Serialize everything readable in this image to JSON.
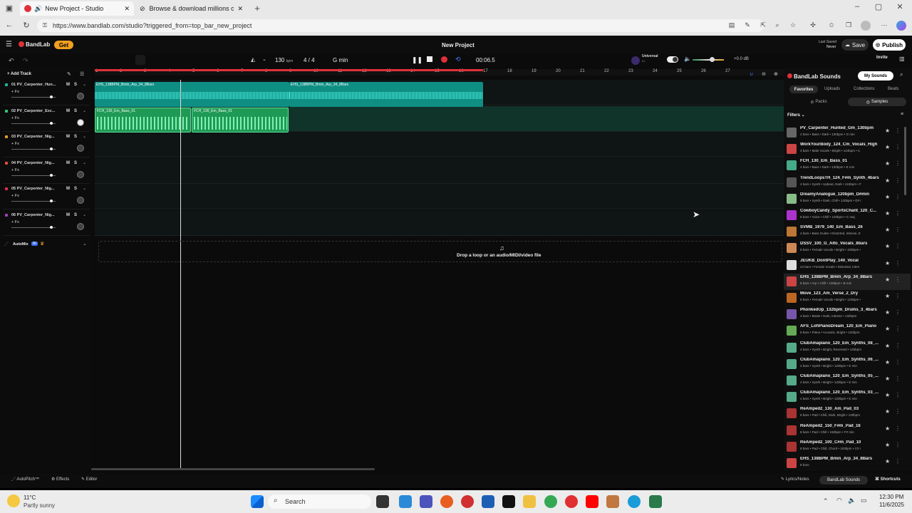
{
  "browser": {
    "tab1": "New Project - Studio",
    "tab2": "Browse & download millions of p",
    "url": "https://www.bandlab.com/studio?triggered_from=top_bar_new_project"
  },
  "header": {
    "brand": "BandLab",
    "get": "Get",
    "title": "New Project",
    "last_saved_label": "Last Saved",
    "last_saved_value": "Never",
    "save": "Save",
    "publish": "Publish",
    "invite": "Invite"
  },
  "transport": {
    "bpm": "130",
    "bpm_unit": "bpm",
    "signature": "4 / 4",
    "key": "G min",
    "time": "00:06.5",
    "universal": "Universal",
    "universal_sub": "60",
    "db": "+0.0 dB"
  },
  "tracks_panel": {
    "add_track": "Add Track",
    "automix": "AutoMix",
    "ai": "AI"
  },
  "tracks": [
    {
      "name": "01 PV_Carpenter_Hun...",
      "fx": "+ Fx"
    },
    {
      "name": "02 PV_Carpenter_Exc...",
      "fx": "+ Fx"
    },
    {
      "name": "03 PV_Carpenter_Nig...",
      "fx": "+ Fx"
    },
    {
      "name": "04 PV_Carpenter_Nig...",
      "fx": "+ Fx"
    },
    {
      "name": "05 PV_Carpenter_Nig...",
      "fx": "+ Fx"
    },
    {
      "name": "06 PV_Carpenter_Nig...",
      "fx": "+ Fx"
    }
  ],
  "track_controls": {
    "mute": "M",
    "solo": "S"
  },
  "ruler": [
    "1",
    "2",
    "3",
    "4",
    "5",
    "6",
    "7",
    "8",
    "9",
    "10",
    "11",
    "12",
    "13",
    "14",
    "15",
    "16",
    "17",
    "18",
    "19",
    "20",
    "21",
    "22",
    "23",
    "24",
    "25",
    "26",
    "27"
  ],
  "clips": {
    "a": "EHS_138BPM_Bmin_Arp_34_8Bars",
    "b": "EHS_138BPM_Bmin_Arp_34_8Bars",
    "c": "FCH_130_Em_Bass_01",
    "d": "FCH_130_Em_Bass_01"
  },
  "drop_text": "Drop a loop or an audio/MIDI/video file",
  "sounds_panel": {
    "title": "BandLab Sounds",
    "my_sounds": "My Sounds",
    "tabs": [
      "Favorites",
      "Uploads",
      "Collections",
      "Beats"
    ],
    "packs": "Packs",
    "samples": "Samples",
    "filters": "Filters"
  },
  "sounds": [
    {
      "title": "PV_Carpenter_Hunted_Gm_130bpm",
      "meta": "4 bars • Bass • Dark • 130bpm • G min",
      "color": "#666"
    },
    {
      "title": "WorkYourBody_124_Cm_Vocals_High",
      "meta": "4 bars • Male Vocals • Bright • 124bpm • C",
      "color": "#c44"
    },
    {
      "title": "FCH_130_Em_Bass_01",
      "meta": "4 bars • Bass • Dark • 130bpm • E min",
      "color": "#4a8"
    },
    {
      "title": "TrendLoopsTH_124_F#m_Synth_4bars",
      "meta": "4 bars • Synth • Upbeat, Dark • 124bpm • F",
      "color": "#555"
    },
    {
      "title": "DreamyAnalogue_120bpm_D#min",
      "meta": "9 bars • Synth • Dark, Chill • 120bpm • D# r",
      "color": "#8b8"
    },
    {
      "title": "CowboyCandy_SportsChant_120_C...",
      "meta": "8 bars • Voice • Chill • 120bpm • C maj",
      "color": "#a3c"
    },
    {
      "title": "SVMB_1979_140_Em_Bass_26",
      "meta": "4 bars • Bass Guitar • Distorted, Intense, E",
      "color": "#b73"
    },
    {
      "title": "DSSV_100_G_Alto_Vocals_8bars",
      "meta": "8 bars • Female Vocals • Bright • 100bpm •",
      "color": "#c85"
    },
    {
      "title": "JEUKB_DontPlay_140_Vocal",
      "meta": "24 bars • Female Vocals • Distorted, Inten",
      "color": "#ddd"
    },
    {
      "title": "EHS_138BPM_Bmin_Arp_34_8Bars",
      "meta": "8 bars • Arp • Chill • 138bpm • B min",
      "color": "#c44"
    },
    {
      "title": "Move_123_Am_Verse_2_Dry",
      "meta": "8 bars • Female Vocals • Bright • 123bpm •",
      "color": "#b62"
    },
    {
      "title": "PhonkedUp_132bpm_Drums_3_4bars",
      "meta": "4 bars • Beats • Dark, Intense • 132bpm",
      "color": "#75a"
    },
    {
      "title": "AFS_LofiPianoDream_120_Em_Piano",
      "meta": "8 bars • Piano • Acoustic, Bright • 120bpm",
      "color": "#6a5"
    },
    {
      "title": "ClubAmapiano_120_Em_Synths_08_...",
      "meta": "4 bars • Synth • Bright, Reversed • 120bpm",
      "color": "#5a8"
    },
    {
      "title": "ClubAmapiano_120_Em_Synths_06_...",
      "meta": "4 bars • Synth • Bright • 120bpm • E min",
      "color": "#5a8"
    },
    {
      "title": "ClubAmapiano_120_Em_Synths_05_...",
      "meta": "4 bars • Synth • Bright • 120bpm • E min",
      "color": "#5a8"
    },
    {
      "title": "ClubAmapiano_120_Em_Synths_03_...",
      "meta": "4 bars • Synth • Bright • 120bpm • E min",
      "color": "#5a8"
    },
    {
      "title": "ReAmped2_130_Am_Pad_03",
      "meta": "8 bars • Pad • Chill, Dark, Bright • 130bpm",
      "color": "#a33"
    },
    {
      "title": "ReAmped2_150_F#m_Pad_16",
      "meta": "8 bars • Pad • Chill • 150bpm • F# min",
      "color": "#a33"
    },
    {
      "title": "ReAmped2_100_C#m_Pad_10",
      "meta": "8 bars • Pad • Chill, Chord • 100bpm • C# r",
      "color": "#a33"
    },
    {
      "title": "EHS_138BPM_Bmin_Arp_34_8Bars",
      "meta": "8 bars",
      "color": "#c44"
    }
  ],
  "footer": {
    "autopitch": "AutoPitch™",
    "effects": "Effects",
    "editor": "Editor",
    "lyrics": "Lyrics/Notes",
    "bandlab_sounds": "BandLab Sounds",
    "shortcuts": "Shortcuts"
  },
  "taskbar": {
    "temp": "11°C",
    "weather": "Partly sunny",
    "search": "Search",
    "time": "12:30 PM",
    "date": "11/6/2025"
  },
  "colors": {
    "accent": "#e0303a",
    "teal": "#1fb5a8",
    "green": "#2ecc71"
  }
}
